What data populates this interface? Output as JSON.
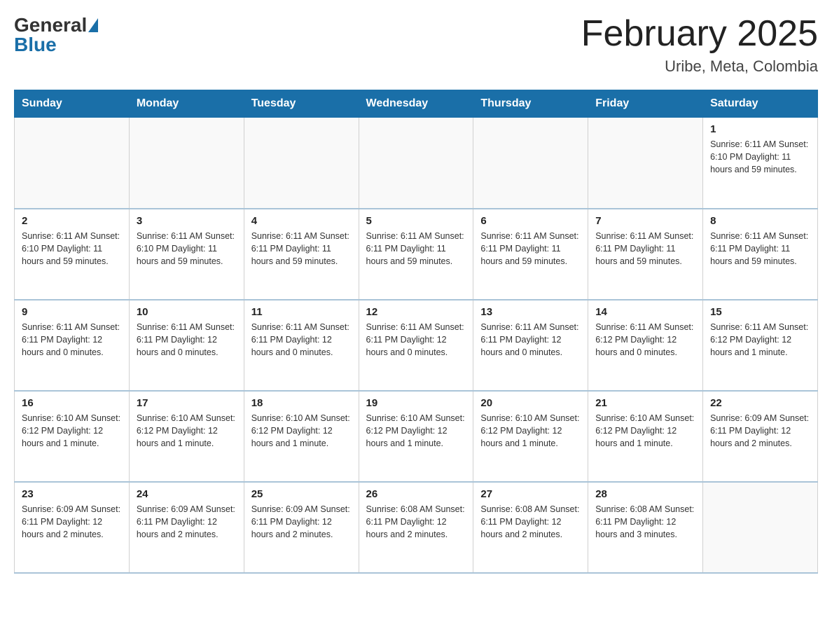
{
  "header": {
    "logo": {
      "general": "General",
      "blue": "Blue"
    },
    "title": "February 2025",
    "location": "Uribe, Meta, Colombia"
  },
  "calendar": {
    "days_of_week": [
      "Sunday",
      "Monday",
      "Tuesday",
      "Wednesday",
      "Thursday",
      "Friday",
      "Saturday"
    ],
    "weeks": [
      [
        {
          "day": "",
          "info": ""
        },
        {
          "day": "",
          "info": ""
        },
        {
          "day": "",
          "info": ""
        },
        {
          "day": "",
          "info": ""
        },
        {
          "day": "",
          "info": ""
        },
        {
          "day": "",
          "info": ""
        },
        {
          "day": "1",
          "info": "Sunrise: 6:11 AM\nSunset: 6:10 PM\nDaylight: 11 hours and 59 minutes."
        }
      ],
      [
        {
          "day": "2",
          "info": "Sunrise: 6:11 AM\nSunset: 6:10 PM\nDaylight: 11 hours and 59 minutes."
        },
        {
          "day": "3",
          "info": "Sunrise: 6:11 AM\nSunset: 6:10 PM\nDaylight: 11 hours and 59 minutes."
        },
        {
          "day": "4",
          "info": "Sunrise: 6:11 AM\nSunset: 6:11 PM\nDaylight: 11 hours and 59 minutes."
        },
        {
          "day": "5",
          "info": "Sunrise: 6:11 AM\nSunset: 6:11 PM\nDaylight: 11 hours and 59 minutes."
        },
        {
          "day": "6",
          "info": "Sunrise: 6:11 AM\nSunset: 6:11 PM\nDaylight: 11 hours and 59 minutes."
        },
        {
          "day": "7",
          "info": "Sunrise: 6:11 AM\nSunset: 6:11 PM\nDaylight: 11 hours and 59 minutes."
        },
        {
          "day": "8",
          "info": "Sunrise: 6:11 AM\nSunset: 6:11 PM\nDaylight: 11 hours and 59 minutes."
        }
      ],
      [
        {
          "day": "9",
          "info": "Sunrise: 6:11 AM\nSunset: 6:11 PM\nDaylight: 12 hours and 0 minutes."
        },
        {
          "day": "10",
          "info": "Sunrise: 6:11 AM\nSunset: 6:11 PM\nDaylight: 12 hours and 0 minutes."
        },
        {
          "day": "11",
          "info": "Sunrise: 6:11 AM\nSunset: 6:11 PM\nDaylight: 12 hours and 0 minutes."
        },
        {
          "day": "12",
          "info": "Sunrise: 6:11 AM\nSunset: 6:11 PM\nDaylight: 12 hours and 0 minutes."
        },
        {
          "day": "13",
          "info": "Sunrise: 6:11 AM\nSunset: 6:11 PM\nDaylight: 12 hours and 0 minutes."
        },
        {
          "day": "14",
          "info": "Sunrise: 6:11 AM\nSunset: 6:12 PM\nDaylight: 12 hours and 0 minutes."
        },
        {
          "day": "15",
          "info": "Sunrise: 6:11 AM\nSunset: 6:12 PM\nDaylight: 12 hours and 1 minute."
        }
      ],
      [
        {
          "day": "16",
          "info": "Sunrise: 6:10 AM\nSunset: 6:12 PM\nDaylight: 12 hours and 1 minute."
        },
        {
          "day": "17",
          "info": "Sunrise: 6:10 AM\nSunset: 6:12 PM\nDaylight: 12 hours and 1 minute."
        },
        {
          "day": "18",
          "info": "Sunrise: 6:10 AM\nSunset: 6:12 PM\nDaylight: 12 hours and 1 minute."
        },
        {
          "day": "19",
          "info": "Sunrise: 6:10 AM\nSunset: 6:12 PM\nDaylight: 12 hours and 1 minute."
        },
        {
          "day": "20",
          "info": "Sunrise: 6:10 AM\nSunset: 6:12 PM\nDaylight: 12 hours and 1 minute."
        },
        {
          "day": "21",
          "info": "Sunrise: 6:10 AM\nSunset: 6:12 PM\nDaylight: 12 hours and 1 minute."
        },
        {
          "day": "22",
          "info": "Sunrise: 6:09 AM\nSunset: 6:11 PM\nDaylight: 12 hours and 2 minutes."
        }
      ],
      [
        {
          "day": "23",
          "info": "Sunrise: 6:09 AM\nSunset: 6:11 PM\nDaylight: 12 hours and 2 minutes."
        },
        {
          "day": "24",
          "info": "Sunrise: 6:09 AM\nSunset: 6:11 PM\nDaylight: 12 hours and 2 minutes."
        },
        {
          "day": "25",
          "info": "Sunrise: 6:09 AM\nSunset: 6:11 PM\nDaylight: 12 hours and 2 minutes."
        },
        {
          "day": "26",
          "info": "Sunrise: 6:08 AM\nSunset: 6:11 PM\nDaylight: 12 hours and 2 minutes."
        },
        {
          "day": "27",
          "info": "Sunrise: 6:08 AM\nSunset: 6:11 PM\nDaylight: 12 hours and 2 minutes."
        },
        {
          "day": "28",
          "info": "Sunrise: 6:08 AM\nSunset: 6:11 PM\nDaylight: 12 hours and 3 minutes."
        },
        {
          "day": "",
          "info": ""
        }
      ]
    ]
  }
}
